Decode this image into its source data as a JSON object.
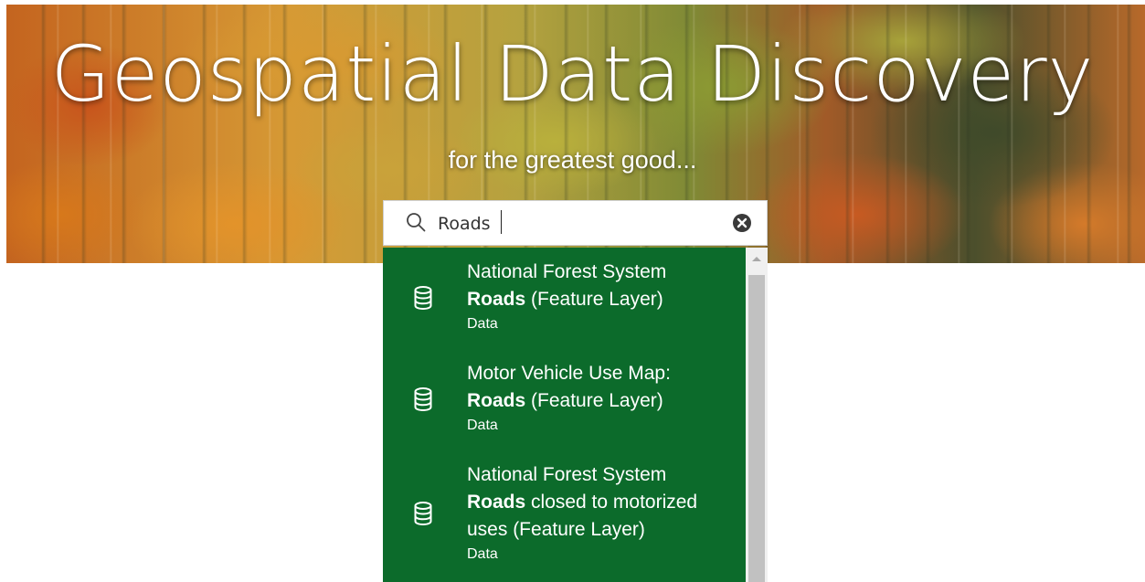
{
  "hero": {
    "title": "Geospatial Data Discovery",
    "subtitle": "for the greatest good..."
  },
  "search": {
    "value": "Roads",
    "clear_icon": "clear-circle-x-icon",
    "search_icon": "magnifier-icon"
  },
  "results": [
    {
      "line1": "National Forest System",
      "match": "Roads",
      "rest": " (Feature Layer)",
      "extra": "",
      "type": "Data",
      "icon": "database-icon"
    },
    {
      "line1": "Motor Vehicle Use Map:",
      "match": "Roads",
      "rest": " (Feature Layer)",
      "extra": "",
      "type": "Data",
      "icon": "database-icon"
    },
    {
      "line1": "National Forest System",
      "match": "Roads",
      "rest": " closed to motorized",
      "extra": "uses (Feature Layer)",
      "type": "Data",
      "icon": "database-icon"
    }
  ],
  "colors": {
    "dropdown_bg": "#0c6b2b",
    "text": "#ffffff"
  }
}
